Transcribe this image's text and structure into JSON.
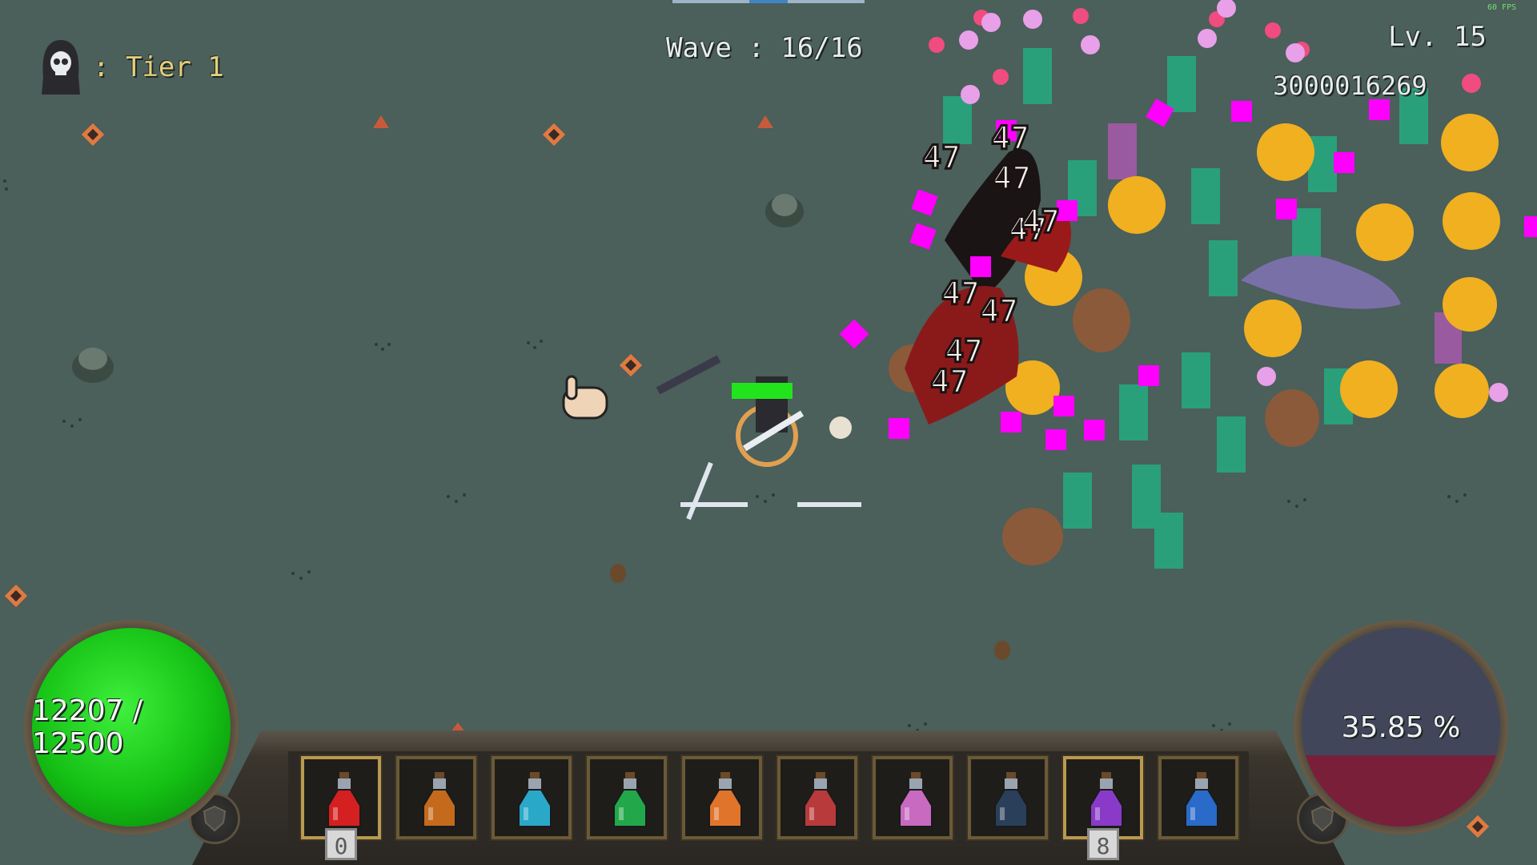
{
  "hud": {
    "tier_label": ": Tier 1",
    "wave": "Wave : 16/16",
    "level": "Lv. 15",
    "score": "3000016269",
    "fps": "60 FPS"
  },
  "health": {
    "text": "12207 / 12500",
    "fraction": 0.9766,
    "color": "#1fcc1a"
  },
  "experience": {
    "text": "35.85 %",
    "fraction": 0.3585,
    "color": "#7a1f3a"
  },
  "player_health_bar": {
    "fraction": 1.0,
    "color": "#22e41c"
  },
  "damage_numbers": [
    "47",
    "47",
    "47",
    "47",
    "47",
    "47",
    "47",
    "47",
    "47"
  ],
  "potions": [
    {
      "icon": "red-potion-icon",
      "color": "#d42020",
      "count": "0"
    },
    {
      "icon": "orange-potion-icon",
      "color": "#c46a1c",
      "count": ""
    },
    {
      "icon": "cyan-potion-icon",
      "color": "#2aa8c8",
      "count": ""
    },
    {
      "icon": "green-potion-icon",
      "color": "#22a84a",
      "count": ""
    },
    {
      "icon": "fire-potion-icon",
      "color": "#e0742a",
      "count": ""
    },
    {
      "icon": "crimson-potion-icon",
      "color": "#b83a3a",
      "count": ""
    },
    {
      "icon": "pink-potion-icon",
      "color": "#c86ac0",
      "count": ""
    },
    {
      "icon": "dark-potion-icon",
      "color": "#2a3f5a",
      "count": ""
    },
    {
      "icon": "purple-potion-icon",
      "color": "#8a3ac8",
      "count": "8"
    },
    {
      "icon": "blue-potion-icon",
      "color": "#2a6ac8",
      "count": ""
    }
  ]
}
